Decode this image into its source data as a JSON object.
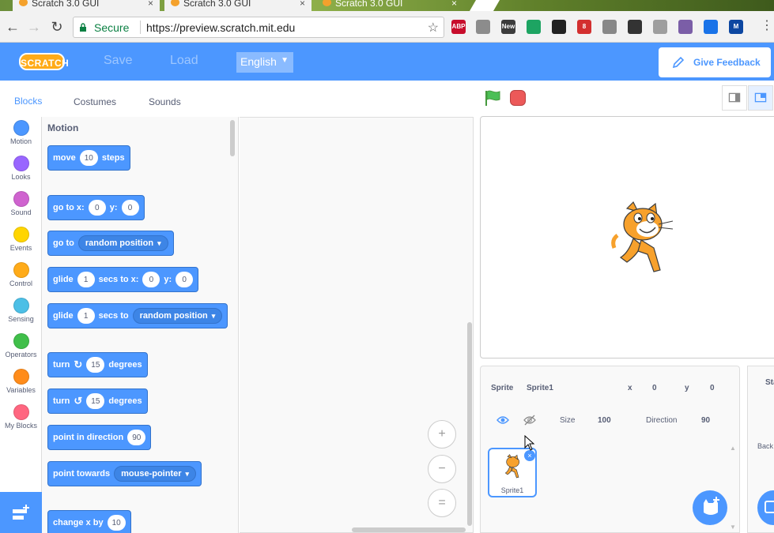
{
  "browser": {
    "tabs": [
      {
        "title": "Scratch 3.0 GUI"
      },
      {
        "title": "Scratch 3.0 GUI"
      },
      {
        "title": "Scratch 3.0 GUI"
      }
    ],
    "close_glyph": "×",
    "secure_label": "Secure",
    "url": "https://preview.scratch.mit.edu",
    "extensions": [
      {
        "icon": "abp-icon",
        "text": "ABP",
        "color": "#c70d2c"
      },
      {
        "icon": "drive-icon",
        "text": "",
        "color": "#8c8c8c"
      },
      {
        "icon": "new-extension-icon",
        "text": "New",
        "color": "#3c3c3c"
      },
      {
        "icon": "green-ring-icon",
        "text": "",
        "color": "#1da462"
      },
      {
        "icon": "react-icon",
        "text": "",
        "color": "#222"
      },
      {
        "icon": "counter-icon",
        "text": "8",
        "color": "#d32f2f"
      },
      {
        "icon": "gray-circle-icon",
        "text": "",
        "color": "#888"
      },
      {
        "icon": "half-circle-icon",
        "text": "",
        "color": "#333"
      },
      {
        "icon": "grid-icon",
        "text": "",
        "color": "#9e9e9e"
      },
      {
        "icon": "eyedropper-icon",
        "text": "",
        "color": "#7b5ea7"
      },
      {
        "icon": "translate-icon",
        "text": "",
        "color": "#1a73e8"
      },
      {
        "icon": "m-icon",
        "text": "M",
        "color": "#0d47a1"
      }
    ]
  },
  "menu": {
    "logo": "SCRATCH",
    "save": "Save",
    "load": "Load",
    "language": "English",
    "feedback": "Give Feedback"
  },
  "editor_tabs": {
    "blocks": "Blocks",
    "costumes": "Costumes",
    "sounds": "Sounds"
  },
  "categories": [
    {
      "label": "Motion",
      "color": "#4c97ff"
    },
    {
      "label": "Looks",
      "color": "#9966ff"
    },
    {
      "label": "Sound",
      "color": "#cf63cf"
    },
    {
      "label": "Events",
      "color": "#ffd500"
    },
    {
      "label": "Control",
      "color": "#ffab19"
    },
    {
      "label": "Sensing",
      "color": "#4cbfe6"
    },
    {
      "label": "Operators",
      "color": "#40bf4a"
    },
    {
      "label": "Variables",
      "color": "#ff8c1a"
    },
    {
      "label": "My Blocks",
      "color": "#ff6680"
    }
  ],
  "flyout": {
    "heading": "Motion",
    "blocks": {
      "move": {
        "a": "move",
        "v": "10",
        "b": "steps"
      },
      "goto_xy": {
        "a": "go to x:",
        "x": "0",
        "b": "y:",
        "y": "0"
      },
      "goto": {
        "a": "go to",
        "d": "random position"
      },
      "glide_xy": {
        "a": "glide",
        "v": "1",
        "b": "secs to x:",
        "x": "0",
        "c": "y:",
        "y": "0"
      },
      "glide_to": {
        "a": "glide",
        "v": "1",
        "b": "secs to",
        "d": "random position"
      },
      "turn_right": {
        "a": "turn",
        "v": "15",
        "b": "degrees"
      },
      "turn_left": {
        "a": "turn",
        "v": "15",
        "b": "degrees"
      },
      "point_dir": {
        "a": "point in direction",
        "v": "90"
      },
      "point_towards": {
        "a": "point towards",
        "d": "mouse-pointer"
      },
      "change_x": {
        "a": "change x by",
        "v": "10"
      }
    }
  },
  "zoom": {
    "in": "+",
    "out": "−",
    "reset": "="
  },
  "sprite_info": {
    "sprite_label": "Sprite",
    "sprite_name": "Sprite1",
    "x_label": "x",
    "x": "0",
    "y_label": "y",
    "y": "0",
    "size_label": "Size",
    "size": "100",
    "direction_label": "Direction",
    "direction": "90"
  },
  "sprites": [
    {
      "name": "Sprite1"
    }
  ],
  "stage_pane": {
    "title": "Sta",
    "backdrops": "Back"
  }
}
